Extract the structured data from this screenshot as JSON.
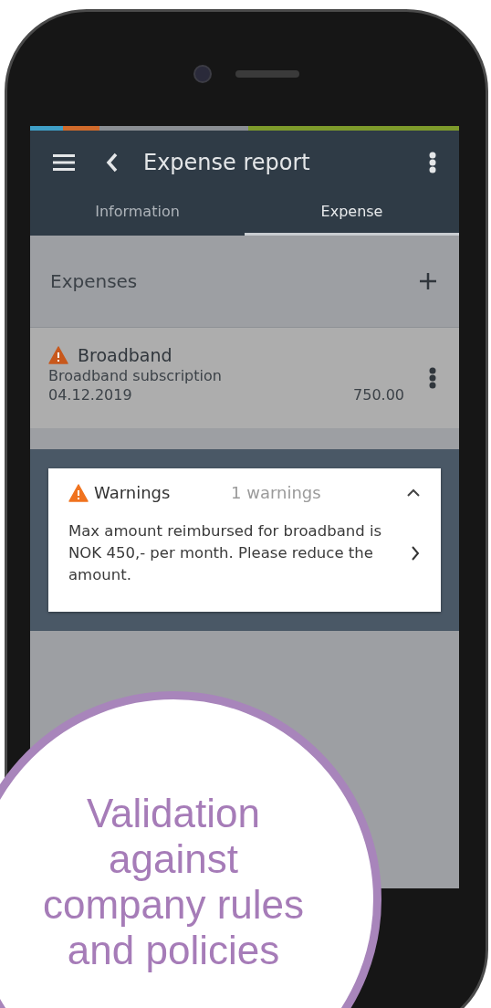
{
  "app_bar": {
    "title": "Expense report"
  },
  "tabs": [
    {
      "label": "Information",
      "selected": false
    },
    {
      "label": "Expense",
      "selected": true
    }
  ],
  "section": {
    "title": "Expenses"
  },
  "expenses": [
    {
      "title": "Broadband",
      "warning": true,
      "description": "Broadband subscription",
      "date": "04.12.2019",
      "amount": "750.00"
    }
  ],
  "warnings_card": {
    "title": "Warnings",
    "count": "1 warnings",
    "expanded": true,
    "message": "Max amount reimbursed for broadband is NOK 450,- per month. Please reduce the amount."
  },
  "callout": {
    "text": "Validation against company rules and policies"
  }
}
